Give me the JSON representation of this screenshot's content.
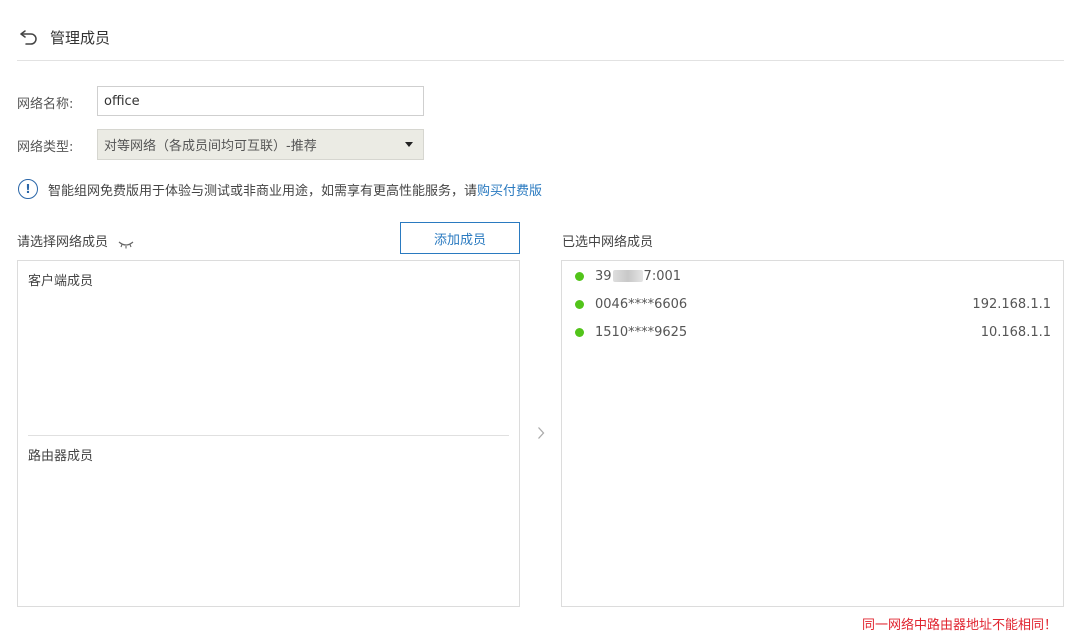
{
  "header": {
    "title": "管理成员"
  },
  "form": {
    "name_label": "网络名称:",
    "name_value": "office",
    "type_label": "网络类型:",
    "type_value": "对等网络（各成员间均可互联）-推荐"
  },
  "notice": {
    "text": "智能组网免费版用于体验与测试或非商业用途，如需享有更高性能服务，请",
    "link": "购买付费版"
  },
  "left_panel": {
    "title": "请选择网络成员",
    "add_button": "添加成员",
    "groups": [
      {
        "label": "客户端成员"
      },
      {
        "label": "路由器成员"
      }
    ]
  },
  "right_panel": {
    "title": "已选中网络成员",
    "members": [
      {
        "id_prefix": "39",
        "id_suffix": "7:001",
        "ip": "",
        "status_color": "#52c41a"
      },
      {
        "id_prefix": "0046****6606",
        "id_suffix": "",
        "ip": "192.168.1.1",
        "status_color": "#52c41a"
      },
      {
        "id_prefix": "1510****9625",
        "id_suffix": "",
        "ip": "10.168.1.1",
        "status_color": "#52c41a"
      }
    ]
  },
  "warning": "同一网络中路由器地址不能相同！",
  "colors": {
    "accent": "#2a7ac0",
    "online": "#52c41a",
    "warning": "#e0242f"
  }
}
